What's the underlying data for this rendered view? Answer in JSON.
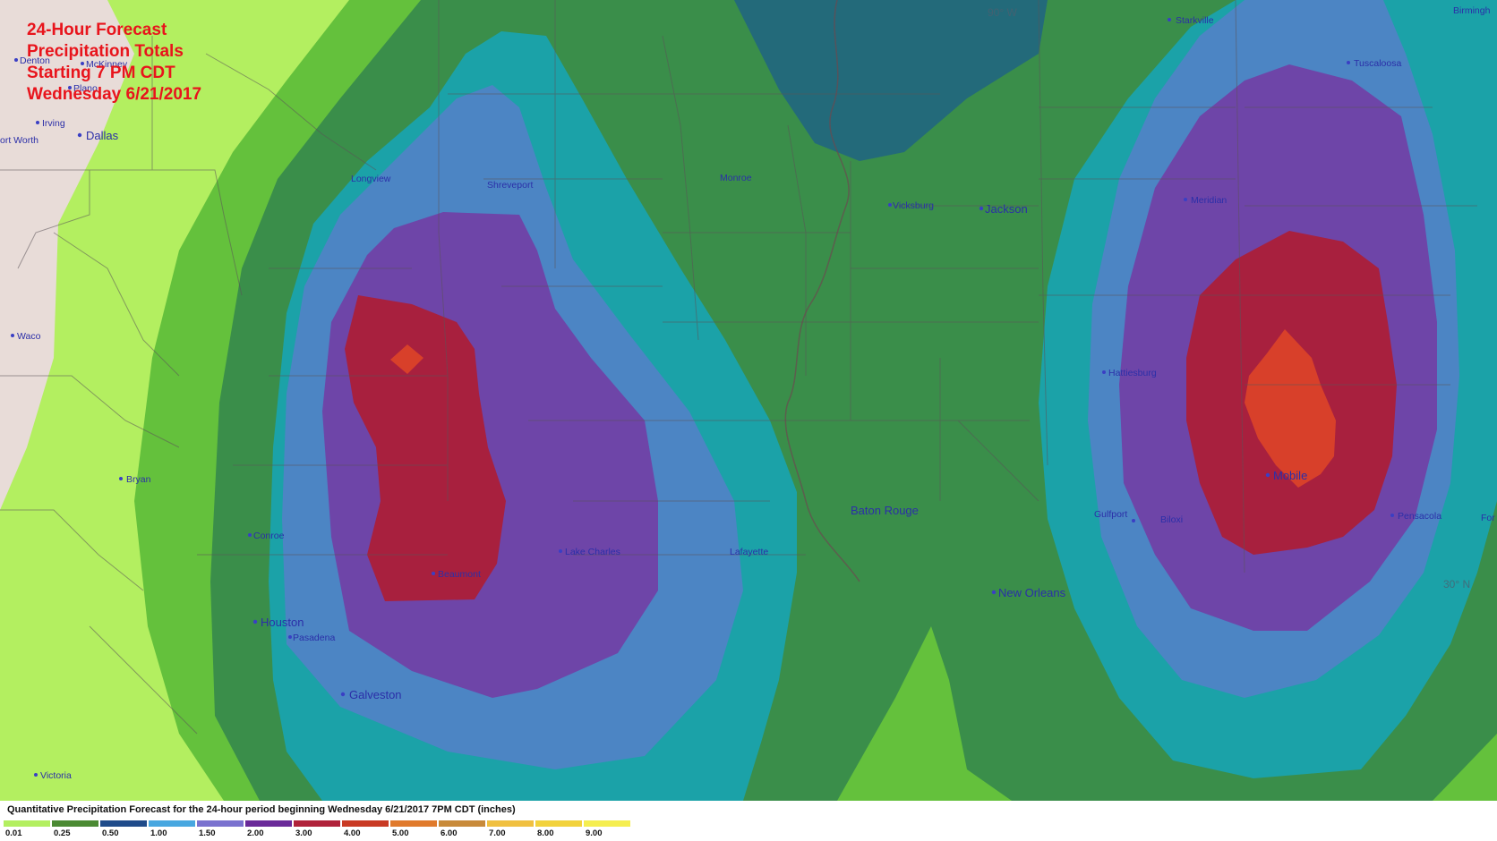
{
  "title_lines": [
    "24-Hour Forecast",
    "Precipitation Totals",
    "Starting 7 PM CDT",
    "Wednesday 6/21/2017"
  ],
  "legend": {
    "title": "Quantitative Precipitation Forecast for the 24-hour period beginning Wednesday 6/21/2017 7PM CDT (inches)",
    "items": [
      {
        "value": "0.01",
        "color": "#b3ef60"
      },
      {
        "value": "0.25",
        "color": "#4b8a33"
      },
      {
        "value": "0.50",
        "color": "#1f4b8a"
      },
      {
        "value": "1.00",
        "color": "#48a7e0"
      },
      {
        "value": "1.50",
        "color": "#7a72cf"
      },
      {
        "value": "2.00",
        "color": "#6a2a99"
      },
      {
        "value": "3.00",
        "color": "#b0223a"
      },
      {
        "value": "4.00",
        "color": "#c93a24"
      },
      {
        "value": "5.00",
        "color": "#e07a2c"
      },
      {
        "value": "6.00",
        "color": "#c88a3a"
      },
      {
        "value": "7.00",
        "color": "#f0c040"
      },
      {
        "value": "8.00",
        "color": "#f2d23c"
      },
      {
        "value": "9.00",
        "color": "#f5ee50"
      }
    ]
  },
  "graticule": {
    "lon": "90° W",
    "lat": "30° N"
  },
  "cities": {
    "denton": "Denton",
    "mckinney": "McKinney",
    "plano": "Plano",
    "irving": "Irving",
    "fort_worth": "ort Worth",
    "dallas": "Dallas",
    "waco": "Waco",
    "bryan": "Bryan",
    "conroe": "Conroe",
    "houston": "Houston",
    "pasadena": "Pasadena",
    "galveston": "Galveston",
    "victoria": "Victoria",
    "longview": "Longview",
    "shreveport": "Shreveport",
    "beaumont": "Beaumont",
    "lake_charles": "Lake Charles",
    "lafayette": "Lafayette",
    "monroe": "Monroe",
    "vicksburg": "Vicksburg",
    "jackson": "Jackson",
    "baton_rouge": "Baton Rouge",
    "new_orleans": "New Orleans",
    "starkville": "Starkville",
    "tuscaloosa": "Tuscaloosa",
    "birmingham": "Birmingh",
    "meridian": "Meridian",
    "hattiesburg": "Hattiesburg",
    "gulfport": "Gulfport",
    "biloxi": "Biloxi",
    "mobile": "Mobile",
    "pensacola": "Pensacola",
    "fort_walton": "For"
  }
}
